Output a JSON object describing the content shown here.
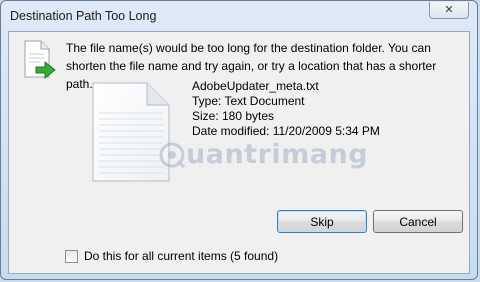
{
  "window": {
    "title": "Destination Path Too Long",
    "close_glyph": "✕"
  },
  "dialog": {
    "message": "The file name(s) would be too long for the destination folder.  You can shorten the file name and try again, or try a location that has a shorter path.",
    "file": {
      "name": "AdobeUpdater_meta.txt",
      "type": "Type: Text Document",
      "size": "Size: 180 bytes",
      "modified": "Date modified: 11/20/2009 5:34 PM"
    },
    "watermark_text": "uantrimang",
    "buttons": {
      "skip": "Skip",
      "cancel": "Cancel"
    },
    "checkbox": {
      "label": "Do this for all current items (5 found)",
      "checked": false
    }
  },
  "icons": {
    "warning": "file-move-arrow-icon",
    "file": "text-document-icon",
    "close": "close-icon"
  },
  "colors": {
    "title_frame": "#c8dcf0",
    "client_bg": "#f0f0f0",
    "arrow_green": "#3aa93a",
    "default_button_border": "#3c7fb1"
  }
}
